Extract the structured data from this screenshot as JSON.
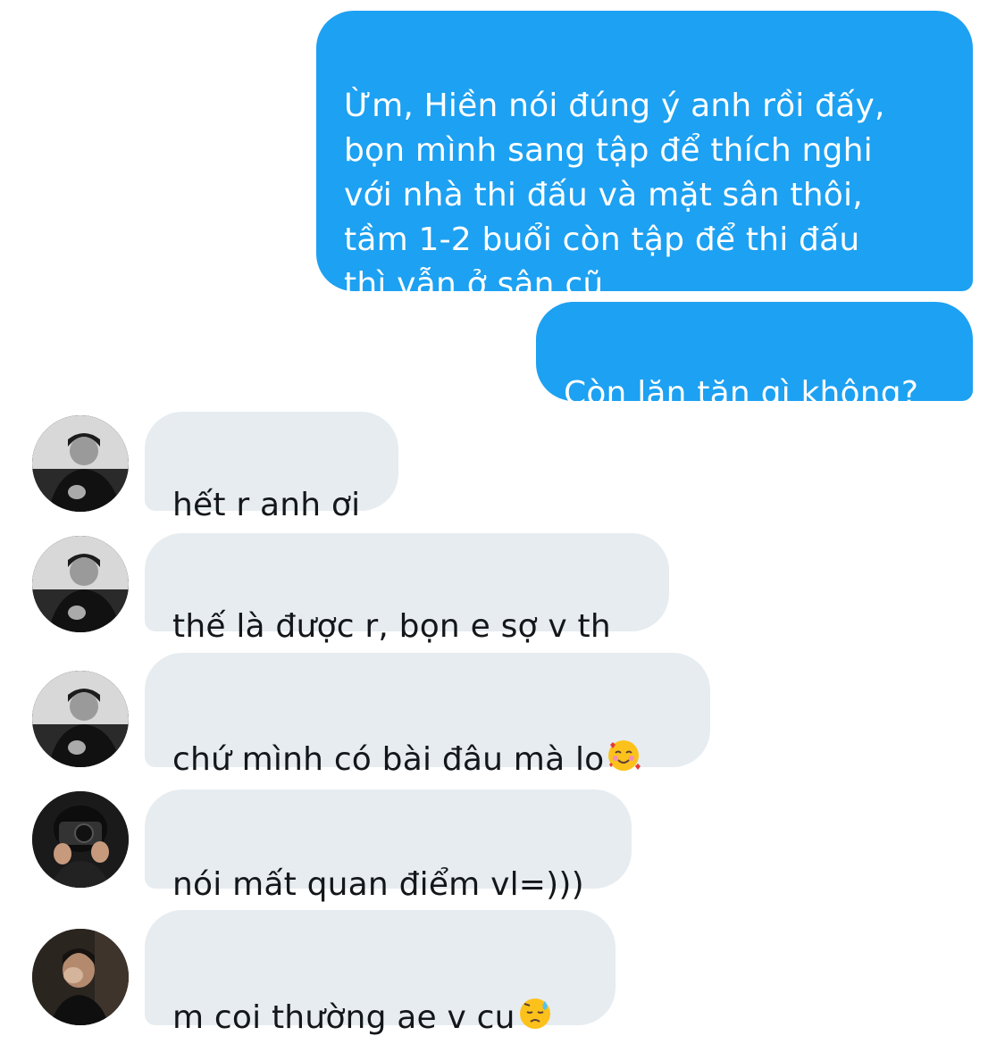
{
  "conversation": {
    "sent_messages": [
      {
        "text": "Ừm, Hiền nói đúng ý anh rồi đấy,\nbọn mình sang tập để thích nghi\nvới nhà thi đấu và mặt sân thôi,\ntầm 1-2 buổi còn tập để thi đấu\nthì vẫn ở sân cũ"
      },
      {
        "text": "Còn lăn tăn gì không?"
      }
    ],
    "received_messages": [
      {
        "text": "hết r anh ơi"
      },
      {
        "text": "thế là được r, bọn e sợ v th"
      },
      {
        "text": "chứ mình có bài đâu mà lo",
        "emoji": "smiling-face-with-hearts"
      },
      {
        "text": "nói mất quan điểm vl=)))"
      },
      {
        "text": "m coi thường ae v cu",
        "emoji": "downcast-face-with-sweat"
      }
    ]
  },
  "colors": {
    "sent_bubble": "#1da1f2",
    "received_bubble": "#e6ecf0",
    "received_text": "#14171a"
  }
}
